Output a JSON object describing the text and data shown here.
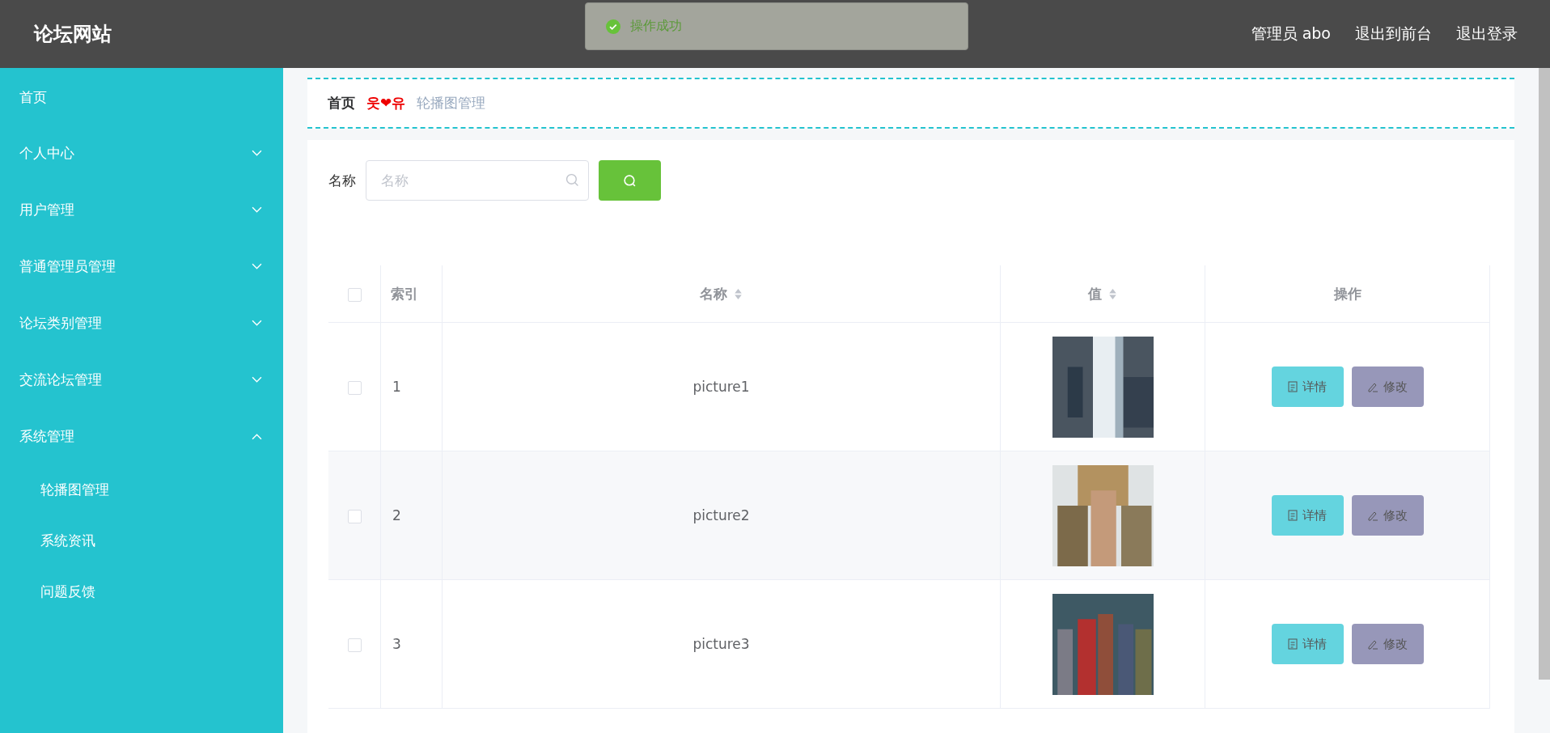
{
  "header": {
    "title": "论坛网站",
    "user": "管理员 abo",
    "links": [
      "退出到前台",
      "退出登录"
    ]
  },
  "toast": {
    "kind": "success",
    "message": "操作成功"
  },
  "sidebar": {
    "items": [
      {
        "label": "首页"
      },
      {
        "label": "个人中心",
        "expanded": false
      },
      {
        "label": "用户管理",
        "expanded": false
      },
      {
        "label": "普通管理员管理",
        "expanded": false
      },
      {
        "label": "论坛类别管理",
        "expanded": false
      },
      {
        "label": "交流论坛管理",
        "expanded": false
      },
      {
        "label": "系统管理",
        "expanded": true,
        "children": [
          {
            "label": "轮播图管理"
          },
          {
            "label": "系统资讯"
          },
          {
            "label": "问题反馈"
          }
        ]
      }
    ]
  },
  "breadcrumb": {
    "home": "首页",
    "separator": "웃❤유",
    "current": "轮播图管理"
  },
  "search": {
    "label": "名称",
    "placeholder": "名称"
  },
  "table": {
    "select_all_checked": false,
    "columns": [
      {
        "label": "索引",
        "sortable": false
      },
      {
        "label": "名称",
        "sortable": true
      },
      {
        "label": "值",
        "sortable": true
      },
      {
        "label": "操作",
        "sortable": false
      }
    ],
    "rows": [
      {
        "index": "1",
        "name": "picture1",
        "value": {
          "kind": "picture"
        },
        "actions": [
          "详情",
          "修改"
        ],
        "checked": false
      },
      {
        "index": "2",
        "name": "picture2",
        "value": {
          "kind": "picture"
        },
        "actions": [
          "详情",
          "修改"
        ],
        "checked": false
      },
      {
        "index": "3",
        "name": "picture3",
        "value": {
          "kind": "picture"
        },
        "actions": [
          "详情",
          "修改"
        ],
        "checked": false
      }
    ]
  }
}
